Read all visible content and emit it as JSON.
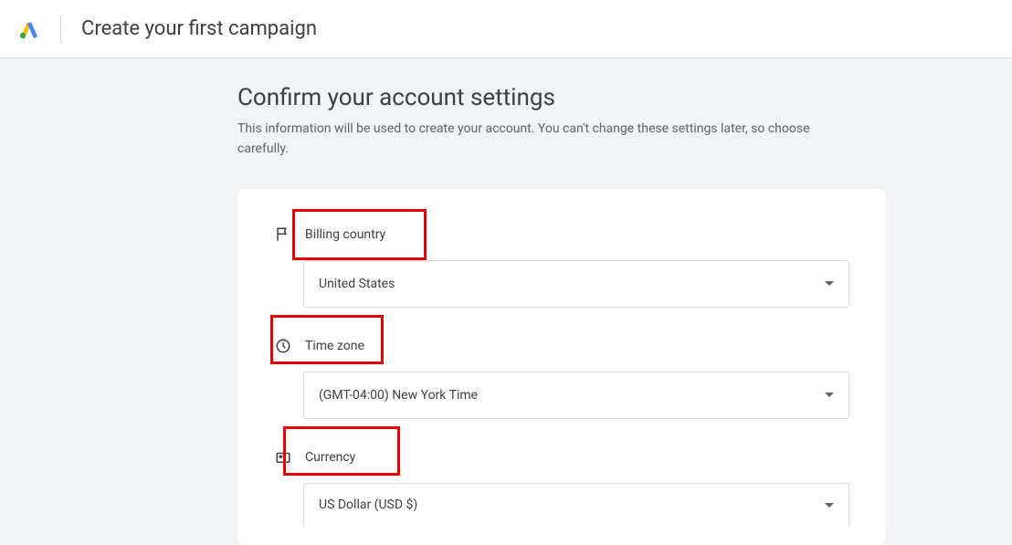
{
  "header": {
    "title": "Create your first campaign"
  },
  "main": {
    "title": "Confirm your account settings",
    "subtitle": "This information will be used to create your account. You can't change these settings later, so choose carefully."
  },
  "fields": {
    "billing_country": {
      "label": "Billing country",
      "value": "United States"
    },
    "time_zone": {
      "label": "Time zone",
      "value": "(GMT-04:00) New York Time"
    },
    "currency": {
      "label": "Currency",
      "value": "US Dollar (USD $)"
    }
  }
}
